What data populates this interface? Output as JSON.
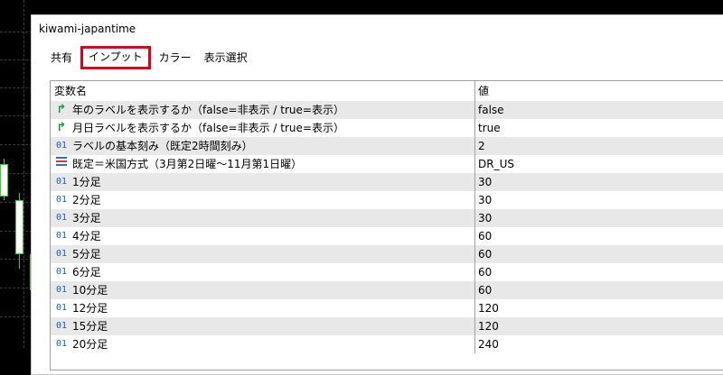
{
  "window": {
    "title": "kiwami-japantime"
  },
  "tabs": [
    "共有",
    "インプット",
    "カラー",
    "表示選択"
  ],
  "table": {
    "headers": {
      "name": "変数名",
      "value": "値"
    },
    "rows": [
      {
        "icon": "bool-icon",
        "name": "年のラベルを表示するか（false=非表示 / true=表示）",
        "value": "false"
      },
      {
        "icon": "bool-icon",
        "name": "月日ラベルを表示するか（false=非表示 / true=表示）",
        "value": "true"
      },
      {
        "icon": "int-icon",
        "name": "ラベルの基本刻み（既定2時間刻み）",
        "value": "2"
      },
      {
        "icon": "enum-icon",
        "name": "既定＝米国方式（3月第2日曜〜11月第1日曜）",
        "value": "DR_US"
      },
      {
        "icon": "int-icon",
        "name": "1分足",
        "value": "30"
      },
      {
        "icon": "int-icon",
        "name": "2分足",
        "value": "30"
      },
      {
        "icon": "int-icon",
        "name": "3分足",
        "value": "30"
      },
      {
        "icon": "int-icon",
        "name": "4分足",
        "value": "60"
      },
      {
        "icon": "int-icon",
        "name": "5分足",
        "value": "60"
      },
      {
        "icon": "int-icon",
        "name": "6分足",
        "value": "60"
      },
      {
        "icon": "int-icon",
        "name": "10分足",
        "value": "60"
      },
      {
        "icon": "int-icon",
        "name": "12分足",
        "value": "120"
      },
      {
        "icon": "int-icon",
        "name": "15分足",
        "value": "120"
      },
      {
        "icon": "int-icon",
        "name": "20分足",
        "value": "240"
      }
    ]
  },
  "icons": {
    "int_glyph": "01",
    "bool_glyph": "↱"
  },
  "colors": {
    "highlight": "#e0001b",
    "bool": "#1a9a3a",
    "int": "#1c5fb0"
  }
}
